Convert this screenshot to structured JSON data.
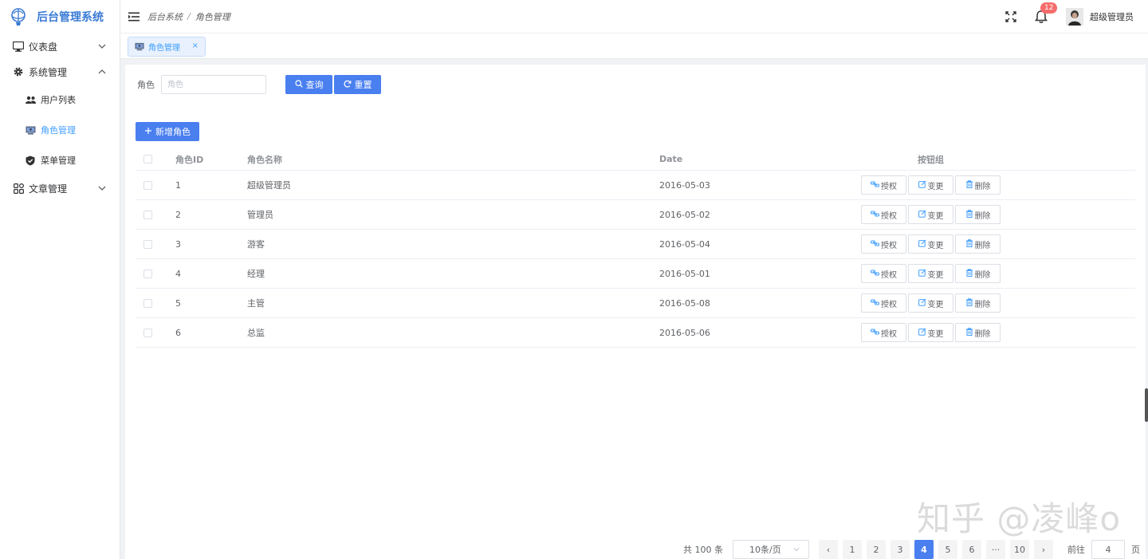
{
  "app": {
    "title": "后台管理系统"
  },
  "sidebar": {
    "items": [
      {
        "label": "仪表盘",
        "icon": "monitor-icon"
      },
      {
        "label": "系统管理",
        "icon": "gear-icon",
        "children": [
          {
            "label": "用户列表",
            "icon": "users-icon"
          },
          {
            "label": "角色管理",
            "icon": "role-icon",
            "active": true
          },
          {
            "label": "菜单管理",
            "icon": "shield-icon"
          }
        ]
      },
      {
        "label": "文章管理",
        "icon": "grid-icon"
      }
    ]
  },
  "header": {
    "breadcrumb": [
      "后台系统",
      "角色管理"
    ],
    "notifications": "12",
    "username": "超级管理员"
  },
  "tags": [
    {
      "label": "角色管理",
      "close": "×"
    }
  ],
  "search": {
    "label": "角色",
    "placeholder": "角色",
    "query_label": "查询",
    "reset_label": "重置"
  },
  "toolbar": {
    "add_label": "新增角色"
  },
  "table": {
    "headers": {
      "id": "角色ID",
      "name": "角色名称",
      "date": "Date",
      "ops": "按钮组"
    },
    "op_labels": {
      "auth": "授权",
      "edit": "变更",
      "del": "删除"
    },
    "rows": [
      {
        "id": "1",
        "name": "超级管理员",
        "date": "2016-05-03"
      },
      {
        "id": "2",
        "name": "管理员",
        "date": "2016-05-02"
      },
      {
        "id": "3",
        "name": "游客",
        "date": "2016-05-04"
      },
      {
        "id": "4",
        "name": "经理",
        "date": "2016-05-01"
      },
      {
        "id": "5",
        "name": "主管",
        "date": "2016-05-08"
      },
      {
        "id": "6",
        "name": "总监",
        "date": "2016-05-06"
      }
    ]
  },
  "pagination": {
    "total": "共 100 条",
    "page_size": "10条/页",
    "prev": "‹",
    "next": "›",
    "pages": [
      "1",
      "2",
      "3",
      "4",
      "5",
      "6",
      "···",
      "10"
    ],
    "current": "4",
    "goto_label": "前往",
    "goto_value": "4",
    "goto_suffix": "页"
  },
  "watermark": "知乎 @凌峰o",
  "colors": {
    "primary": "#4a7ff0",
    "active_text": "#409eff",
    "badge": "#f56c6c"
  }
}
